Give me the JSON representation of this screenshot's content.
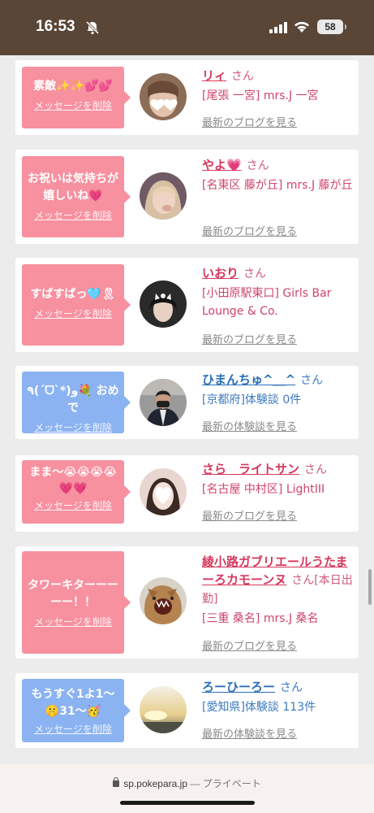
{
  "status_bar": {
    "time": "16:53",
    "battery": "58"
  },
  "messages": [
    {
      "bubble_text": "素敵✨✨💕💕",
      "delete_label": "メッセージを削除",
      "bubble_color": "pink",
      "name": "リィ",
      "honorific": "さん",
      "shop": "[尾張 一宮] mrs.J 一宮",
      "link": "最新のブログを見る",
      "avatar": "face-hearts-avatar"
    },
    {
      "bubble_text": "お祝いは気持ちが嬉しいね💗",
      "delete_label": "メッセージを削除",
      "bubble_color": "pink",
      "name": "やよ💗",
      "honorific": "さん",
      "shop": "[名東区 藤が丘] mrs.J 藤が丘",
      "link": "最新のブログを見る",
      "avatar": "blonde-woman-avatar"
    },
    {
      "bubble_text": "すばすばっ🩵🎗",
      "delete_label": "メッセージを削除",
      "bubble_color": "pink",
      "name": "いおり",
      "honorific": "さん",
      "shop": "[小田原駅東口] Girls Bar Lounge & Co.",
      "link": "最新のブログを見る",
      "avatar": "woman-ribbon-avatar"
    },
    {
      "bubble_text": "٩(ˊᗜˋ*)و💐 おめで",
      "delete_label": "メッセージを削除",
      "bubble_color": "blue",
      "name": "ひまんちゅ^＿^",
      "honorific": "さん",
      "shop": "[京都府]体験談 0件",
      "link": "最新の体験談を見る",
      "avatar": "man-suit-avatar"
    },
    {
      "bubble_text": "まま〜😭😭😭😭💗💗",
      "delete_label": "メッセージを削除",
      "bubble_color": "pink",
      "name": "さら　ライトサン",
      "honorific": "さん",
      "shop": "[名古屋 中村区] LightIII",
      "link": "最新のブログを見る",
      "avatar": "heart-face-avatar"
    },
    {
      "bubble_text": "タワーキターーーーー！！",
      "delete_label": "メッセージを削除",
      "bubble_color": "pink",
      "name": "綾小路ガブリエールうたまーろカモーンヌ",
      "honorific": "さん[本日出勤]",
      "shop": "[三重 桑名] mrs.J 桑名",
      "link": "最新のブログを見る",
      "avatar": "cat-avatar"
    },
    {
      "bubble_text": "もうすぐ1よ1〜🤫31〜🥳",
      "delete_label": "メッセージを削除",
      "bubble_color": "blue",
      "name": "ろーひーろー",
      "honorific": "さん",
      "shop": "[愛知県]体験談 113件",
      "link": "最新の体験談を見る",
      "avatar": "sunset-avatar"
    }
  ],
  "browser": {
    "domain": "sp.pokepara.jp",
    "mode": "— プライベート"
  }
}
